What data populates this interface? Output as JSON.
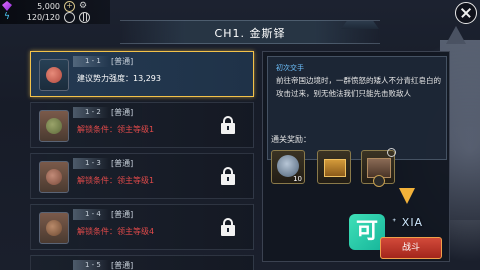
{
  "hud": {
    "gems": "5,000",
    "energy": "120/120"
  },
  "header": {
    "title": "CH1. 金斯铎"
  },
  "stages": [
    {
      "num": "1 - 1",
      "tag": "[普通]",
      "info": "建议势力强度：13,293",
      "locked": false
    },
    {
      "num": "1 - 2",
      "tag": "[普通]",
      "info": "解锁条件：领主等级1",
      "locked": true
    },
    {
      "num": "1 - 3",
      "tag": "[普通]",
      "info": "解锁条件：领主等级1",
      "locked": true
    },
    {
      "num": "1 - 4",
      "tag": "[普通]",
      "info": "解锁条件：领主等级4",
      "locked": true
    },
    {
      "num": "1 - 5",
      "tag": "[普通]",
      "info": "",
      "locked": true
    }
  ],
  "detail": {
    "subtitle": "初次交手",
    "description": "前往帝国边境时，一群愤怒的矮人不分青红皂白的攻击过来，别无他法我们只能先击败敌人",
    "rewards_title": "通关奖励：",
    "reward_count": "10"
  },
  "watermark": "ᐩ XIA",
  "battle_label": "战斗",
  "colors": {
    "accent_gold": "#f3c24a",
    "locked_red": "#e24a4a",
    "subtitle_blue": "#6fc3ff",
    "battle_red": "#c23a2c"
  }
}
